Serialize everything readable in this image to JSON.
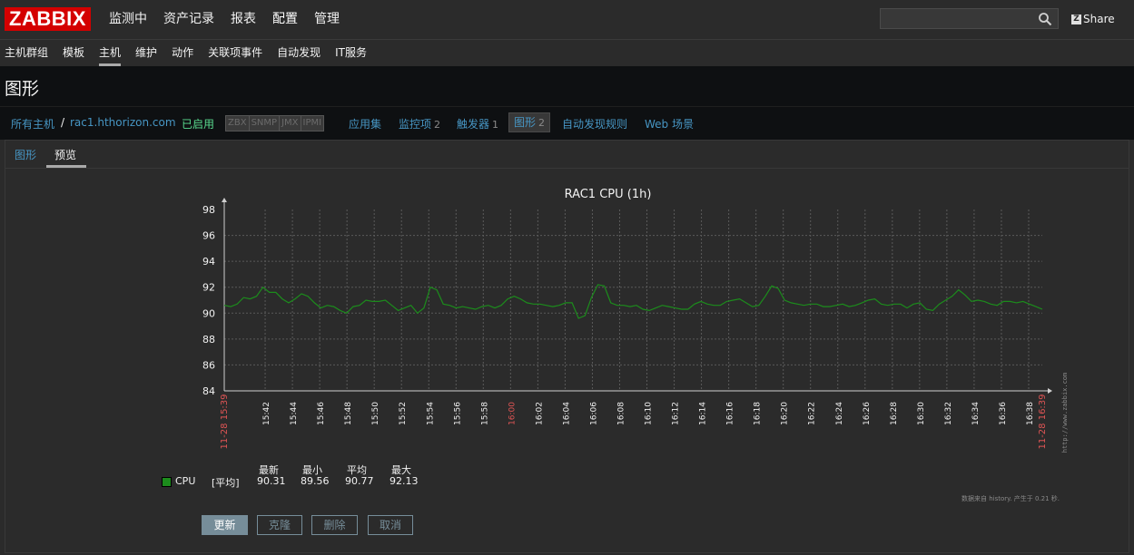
{
  "logo": "ZABBIX",
  "nav": [
    "监测中",
    "资产记录",
    "报表",
    "配置",
    "管理"
  ],
  "share": "Share",
  "share_icon": "Z",
  "subnav": [
    "主机群组",
    "模板",
    "主机",
    "维护",
    "动作",
    "关联项事件",
    "自动发现",
    "IT服务"
  ],
  "page_title": "图形",
  "crumbs": {
    "all_hosts": "所有主机",
    "sep": "/",
    "host": "rac1.hthorizon.com",
    "enabled": "已启用",
    "avail": [
      "ZBX",
      "SNMP",
      "JMX",
      "IPMI"
    ],
    "apps": "应用集",
    "items": "监控项",
    "items_count": "2",
    "triggers": "触发器",
    "triggers_count": "1",
    "graphs": "图形",
    "graphs_count": "2",
    "discovery": "自动发现规则",
    "web": "Web 场景"
  },
  "tabs": [
    "图形",
    "预览"
  ],
  "chart_data": {
    "type": "line",
    "title": "RAC1 CPU (1h)",
    "ylim": [
      84,
      98
    ],
    "yticks": [
      "98",
      "96",
      "94",
      "92",
      "90",
      "88",
      "86",
      "84"
    ],
    "xticks": [
      "15:42",
      "15:44",
      "15:46",
      "15:48",
      "15:50",
      "15:52",
      "15:54",
      "15:56",
      "15:58",
      "16:00",
      "16:02",
      "16:04",
      "16:06",
      "16:08",
      "16:10",
      "16:12",
      "16:14",
      "16:16",
      "16:18",
      "16:20",
      "16:22",
      "16:24",
      "16:26",
      "16:28",
      "16:30",
      "16:32",
      "16:34",
      "16:36",
      "16:38"
    ],
    "xtick_red": "16:00",
    "x_start_label": "11-28 15:39",
    "x_end_label": "11-28 16:39",
    "watermark": "http://www.zabbix.com",
    "series": [
      {
        "name": "CPU",
        "color": "#1c8c1c",
        "values": [
          90.6,
          90.5,
          90.7,
          91.2,
          91.1,
          91.3,
          92.0,
          91.6,
          91.6,
          91.1,
          90.8,
          91.1,
          91.5,
          91.3,
          90.8,
          90.4,
          90.6,
          90.5,
          90.2,
          90.0,
          90.5,
          90.6,
          91.0,
          90.9,
          90.9,
          91.0,
          90.6,
          90.2,
          90.4,
          90.6,
          90.0,
          90.4,
          92.0,
          91.8,
          90.7,
          90.6,
          90.4,
          90.5,
          90.4,
          90.3,
          90.5,
          90.6,
          90.4,
          90.6,
          91.1,
          91.3,
          91.1,
          90.8,
          90.7,
          90.7,
          90.6,
          90.5,
          90.6,
          90.8,
          90.8,
          89.6,
          89.8,
          91.2,
          92.2,
          92.1,
          90.8,
          90.6,
          90.6,
          90.5,
          90.6,
          90.3,
          90.2,
          90.4,
          90.6,
          90.5,
          90.4,
          90.3,
          90.3,
          90.7,
          90.9,
          90.7,
          90.6,
          90.6,
          90.9,
          91.0,
          91.1,
          90.8,
          90.5,
          90.6,
          91.3,
          92.1,
          91.9,
          91.0,
          90.8,
          90.7,
          90.6,
          90.7,
          90.7,
          90.5,
          90.5,
          90.6,
          90.7,
          90.5,
          90.6,
          90.8,
          91.0,
          91.1,
          90.7,
          90.6,
          90.7,
          90.7,
          90.4,
          90.7,
          90.8,
          90.3,
          90.2,
          90.7,
          91.0,
          91.3,
          91.8,
          91.4,
          90.9,
          91.0,
          90.9,
          90.7,
          90.6,
          90.9,
          90.9,
          90.8,
          90.9,
          90.7,
          90.5,
          90.3
        ]
      }
    ]
  },
  "legend": {
    "name": "CPU",
    "func": "[平均]",
    "headers": [
      "最新",
      "最小",
      "平均",
      "最大"
    ],
    "values": [
      "90.31",
      "89.56",
      "90.77",
      "92.13"
    ]
  },
  "footnote": "数据来自 history. 产生于 0.21 秒.",
  "buttons": {
    "update": "更新",
    "clone": "克隆",
    "delete": "删除",
    "cancel": "取消"
  }
}
